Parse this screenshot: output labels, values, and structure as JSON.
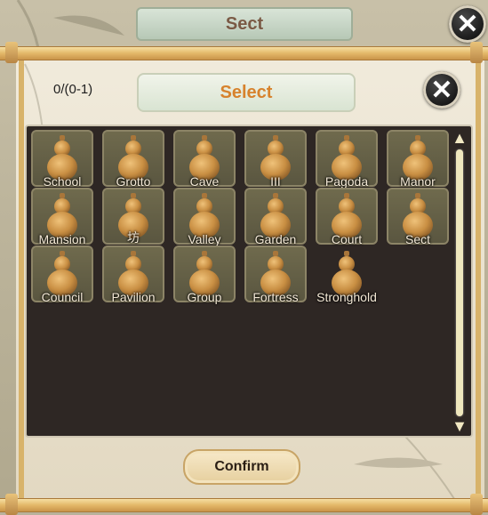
{
  "background": {
    "title": "Sect"
  },
  "dialog": {
    "counter": "0/(0-1)",
    "title": "Select",
    "confirm_label": "Confirm"
  },
  "items": [
    {
      "label": "School"
    },
    {
      "label": "Grotto"
    },
    {
      "label": "Cave"
    },
    {
      "label": "III"
    },
    {
      "label": "Pagoda"
    },
    {
      "label": "Manor"
    },
    {
      "label": "Mansion"
    },
    {
      "label": "坊"
    },
    {
      "label": "Valley"
    },
    {
      "label": "Garden"
    },
    {
      "label": "Court"
    },
    {
      "label": "Sect"
    },
    {
      "label": "Council"
    },
    {
      "label": "Pavilion"
    },
    {
      "label": "Group"
    },
    {
      "label": "Fortress"
    },
    {
      "label": "Stronghold"
    }
  ],
  "colors": {
    "accent": "#d7822c",
    "grid_bg": "#2e2724",
    "gourd": "#c98f43"
  },
  "icons": {
    "close": "close-x-icon",
    "item": "gourd-icon",
    "scroll_up": "arrow-up-icon",
    "scroll_down": "arrow-down-icon"
  }
}
